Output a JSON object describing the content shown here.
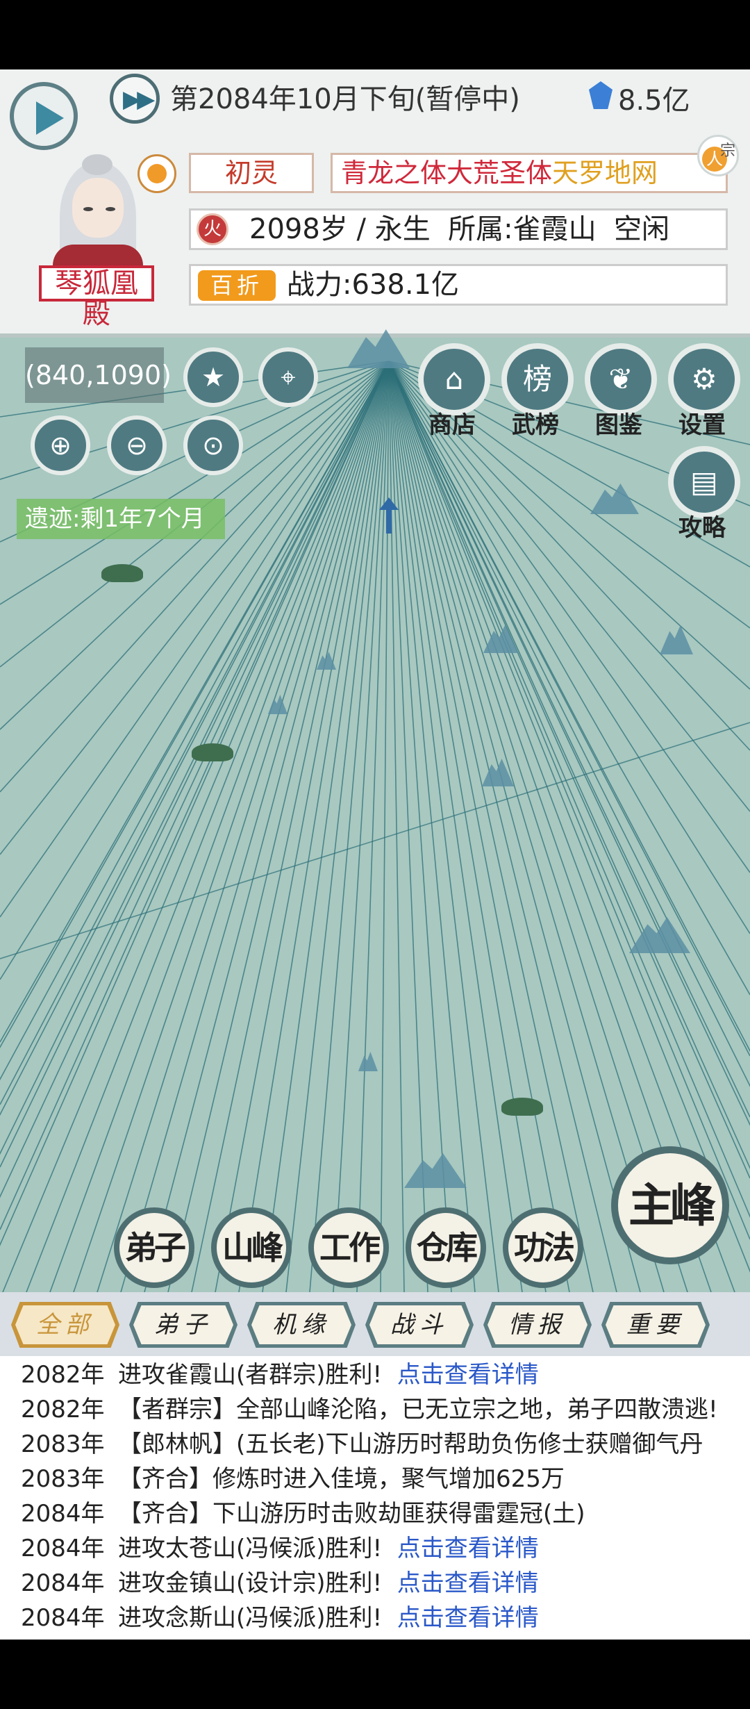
{
  "status": {
    "date": "第2084年10月下旬(暂停中)",
    "spirit_stones": "8.5亿"
  },
  "character": {
    "sect_name": "琴狐凰殿",
    "realm": "初灵",
    "body_a": "青龙之体大荒圣体",
    "body_b": "天罗地网",
    "element": "火",
    "info": "2098岁 / 永生  所属:雀霞山  空闲",
    "badge": "百折",
    "power": "战力:638.1亿",
    "renzong_left": "人",
    "renzong_right": "宗"
  },
  "map": {
    "coord": "(840,1090)",
    "ruins": "遗迹:剩1年7个月",
    "menu": {
      "shop": "商店",
      "ranking": "武榜",
      "codex": "图鉴",
      "settings": "设置",
      "guide": "攻略"
    }
  },
  "actions": {
    "disciples": "弟子",
    "peak": "山峰",
    "work": "工作",
    "warehouse": "仓库",
    "skills": "功法",
    "main_peak": "主峰"
  },
  "tabs": [
    "全部",
    "弟子",
    "机缘",
    "战斗",
    "情报",
    "重要"
  ],
  "log": [
    {
      "year": "2082年",
      "text": "进攻雀霞山(者群宗)胜利!  ",
      "link": "点击查看详情"
    },
    {
      "year": "2082年",
      "text": "【者群宗】全部山峰沦陷，已无立宗之地，弟子四散溃逃!",
      "link": ""
    },
    {
      "year": "2083年",
      "text": "【郎林帆】(五长老)下山游历时帮助负伤修士获赠御气丹",
      "link": ""
    },
    {
      "year": "2083年",
      "text": "【齐合】修炼时进入佳境，聚气增加625万",
      "link": ""
    },
    {
      "year": "2084年",
      "text": "【齐合】下山游历时击败劫匪获得雷霆冠(土)",
      "link": ""
    },
    {
      "year": "2084年",
      "text": "进攻太苍山(冯候派)胜利!  ",
      "link": "点击查看详情"
    },
    {
      "year": "2084年",
      "text": "进攻金镇山(设计宗)胜利!  ",
      "link": "点击查看详情"
    },
    {
      "year": "2084年",
      "text": "进攻念斯山(冯候派)胜利!  ",
      "link": "点击查看详情"
    }
  ]
}
